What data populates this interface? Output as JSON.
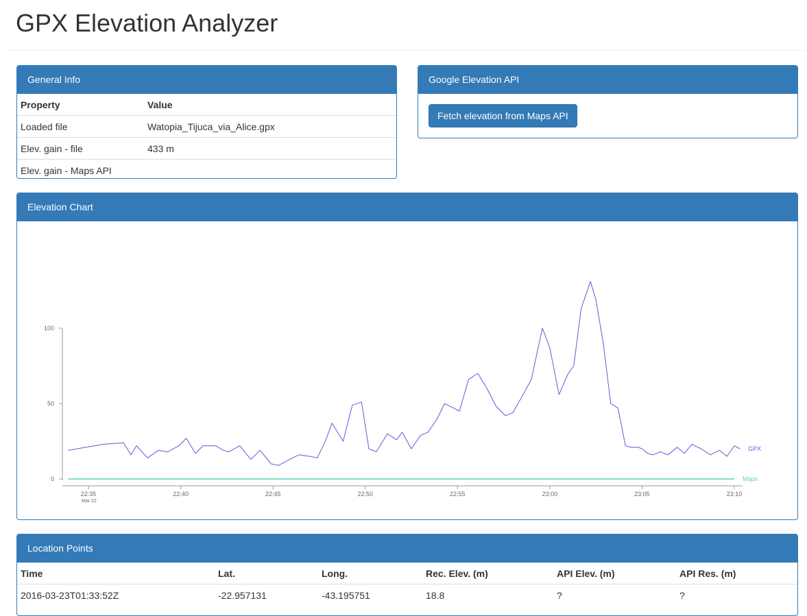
{
  "header": {
    "title": "GPX Elevation Analyzer"
  },
  "general_info": {
    "title": "General Info",
    "columns": [
      "Property",
      "Value"
    ],
    "rows": [
      {
        "property": "Loaded file",
        "value": "Watopia_Tijuca_via_Alice.gpx"
      },
      {
        "property": "Elev. gain - file",
        "value": "433 m"
      },
      {
        "property": "Elev. gain - Maps API",
        "value": ""
      }
    ]
  },
  "google_api": {
    "title": "Google Elevation API",
    "button_label": "Fetch elevation from Maps API"
  },
  "elevation_chart": {
    "title": "Elevation Chart"
  },
  "chart_data": {
    "type": "line",
    "y_ticks": [
      "0",
      "50",
      "100"
    ],
    "x_ticks": [
      "22:35",
      "22:40",
      "22:45",
      "22:50",
      "22:55",
      "23:00",
      "23:05",
      "23:10"
    ],
    "x_sublabel": "Mar 22",
    "ylim": [
      0,
      100
    ],
    "xlim_minutes": [
      0,
      35
    ],
    "series": [
      {
        "name": "GPX",
        "color": "#5b5bdc",
        "x_minutes": [
          -1.1,
          0.8,
          1.9,
          2.3,
          2.6,
          3.2,
          3.8,
          4.3,
          4.9,
          5.3,
          5.8,
          6.2,
          6.9,
          7.3,
          7.6,
          8.2,
          8.8,
          9.3,
          9.9,
          10.3,
          10.9,
          11.4,
          12.0,
          12.4,
          12.8,
          13.2,
          13.8,
          14.3,
          14.8,
          15.2,
          15.6,
          16.2,
          16.7,
          17.0,
          17.5,
          18.0,
          18.4,
          18.9,
          19.3,
          19.8,
          20.1,
          20.6,
          21.1,
          21.6,
          22.1,
          22.6,
          23.0,
          23.6,
          24.0,
          24.6,
          25.0,
          25.5,
          26.0,
          26.3,
          26.7,
          27.2,
          27.5,
          27.9,
          28.3,
          28.7,
          29.1,
          29.4,
          29.8,
          30.0,
          30.3,
          30.6,
          31.0,
          31.4,
          31.9,
          32.3,
          32.7,
          33.2,
          33.7,
          34.2,
          34.6,
          35.0,
          35.3
        ],
        "y": [
          19,
          23,
          24,
          16,
          22,
          14,
          19,
          18,
          22,
          27,
          17,
          22,
          22,
          19,
          18,
          22,
          13,
          19,
          10,
          9,
          13,
          16,
          15,
          14,
          24,
          37,
          25,
          49,
          51,
          20,
          18,
          30,
          26,
          31,
          20,
          29,
          31,
          40,
          50,
          47,
          45,
          66,
          70,
          60,
          48,
          42,
          44,
          57,
          66,
          100,
          87,
          56,
          70,
          75,
          113,
          131,
          119,
          90,
          50,
          47,
          22,
          21,
          21,
          20,
          17,
          16,
          18,
          16,
          21,
          17,
          23,
          20,
          16,
          19,
          15,
          22,
          20
        ]
      },
      {
        "name": "Maps",
        "color": "#5ed0b7",
        "x_minutes": [
          -1.1,
          35.0
        ],
        "y": [
          0,
          0
        ]
      }
    ]
  },
  "location_points": {
    "title": "Location Points",
    "columns": [
      "Time",
      "Lat.",
      "Long.",
      "Rec. Elev. (m)",
      "API Elev. (m)",
      "API Res. (m)"
    ],
    "rows": [
      [
        "2016-03-23T01:33:52Z",
        "-22.957131",
        "-43.195751",
        "18.8",
        "?",
        "?"
      ]
    ]
  }
}
